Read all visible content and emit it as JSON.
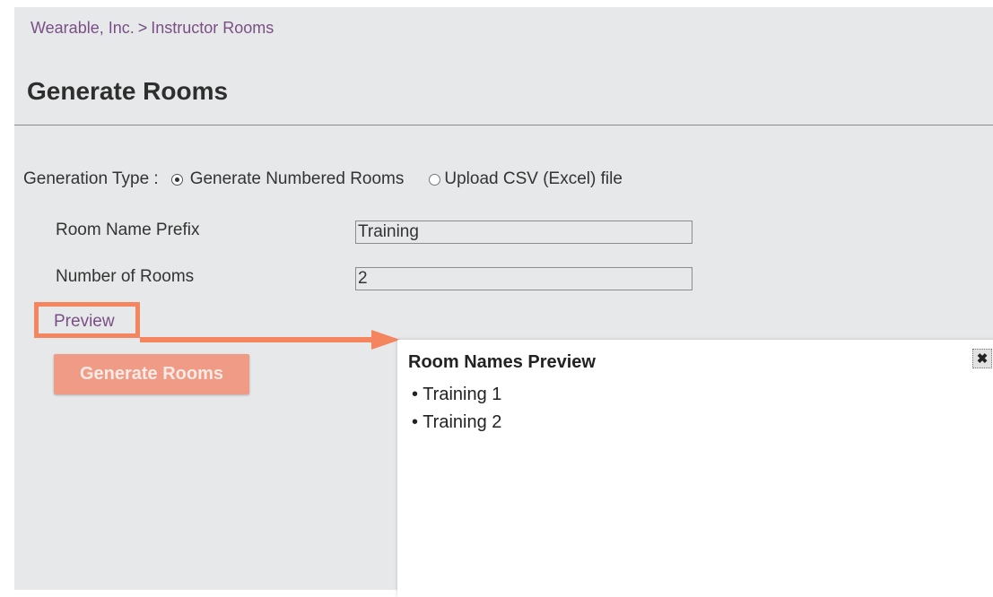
{
  "breadcrumb": {
    "org": "Wearable, Inc.",
    "separator": ">",
    "section": "Instructor Rooms"
  },
  "page": {
    "title": "Generate Rooms"
  },
  "generation_type": {
    "label": "Generation Type :",
    "options": [
      {
        "label": "Generate Numbered Rooms",
        "selected": true
      },
      {
        "label": "Upload CSV (Excel) file",
        "selected": false
      }
    ]
  },
  "form": {
    "prefix_label": "Room Name Prefix",
    "prefix_value": "Training",
    "count_label": "Number of Rooms",
    "count_value": "2"
  },
  "preview_link": "Preview",
  "generate_button": "Generate Rooms",
  "preview_panel": {
    "title": "Room Names Preview",
    "close_icon": "close-icon",
    "rooms": [
      "Training 1",
      "Training 2"
    ]
  },
  "colors": {
    "highlight": "#f5855e",
    "link": "#7a4f86",
    "button": "#ef9b85"
  }
}
